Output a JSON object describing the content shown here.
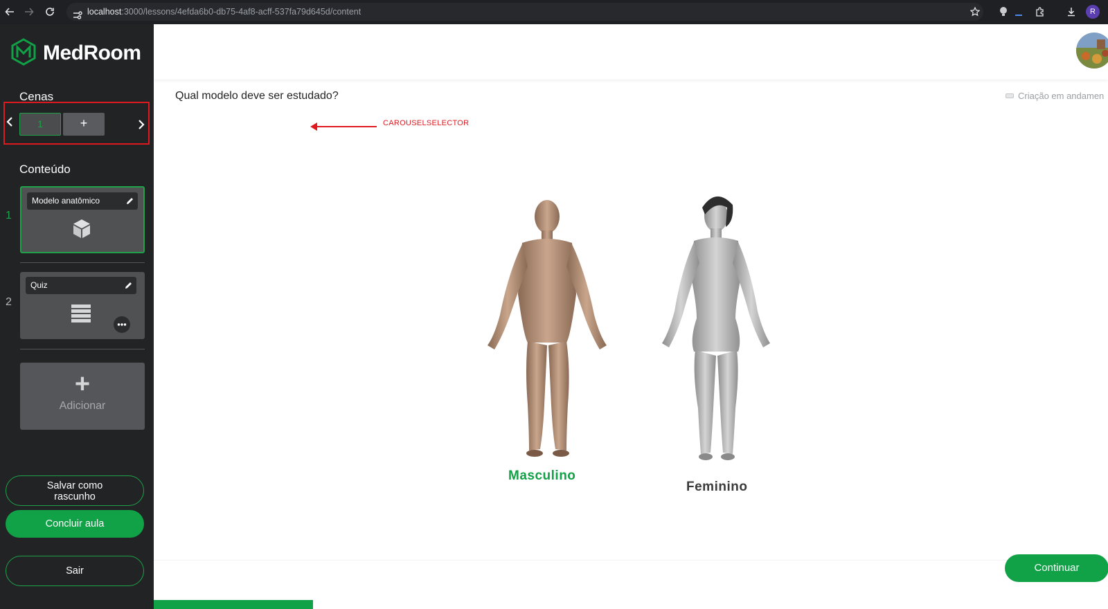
{
  "browser": {
    "url_host": "localhost",
    "url_rest": ":3000/lessons/4efda6b0-db75-4af8-acff-537fa79d645d/content",
    "profile_initial": "R"
  },
  "sidebar": {
    "brand": "MedRoom",
    "scenes_title": "Cenas",
    "scenes": [
      "1"
    ],
    "add_scene_label": "+",
    "content_title": "Conteúdo",
    "content_items": [
      {
        "number": "1",
        "title": "Modelo anatômico",
        "icon": "cube-icon"
      },
      {
        "number": "2",
        "title": "Quiz",
        "icon": "list-icon"
      }
    ],
    "add_content_label": "Adicionar",
    "save_draft_label": "Salvar como rascunho",
    "finish_label": "Concluir aula",
    "exit_label": "Sair"
  },
  "main": {
    "question": "Qual modelo deve ser estudado?",
    "status": "Criação em andamen",
    "annotation": "CAROUSELSELECTOR",
    "options": [
      {
        "label": "Masculino",
        "selected": true
      },
      {
        "label": "Feminino",
        "selected": false
      }
    ],
    "continue_label": "Continuar",
    "progress": 0.167
  },
  "colors": {
    "accent": "#11a146",
    "sidebar_bg": "#222325",
    "annotation": "#e0191f"
  }
}
